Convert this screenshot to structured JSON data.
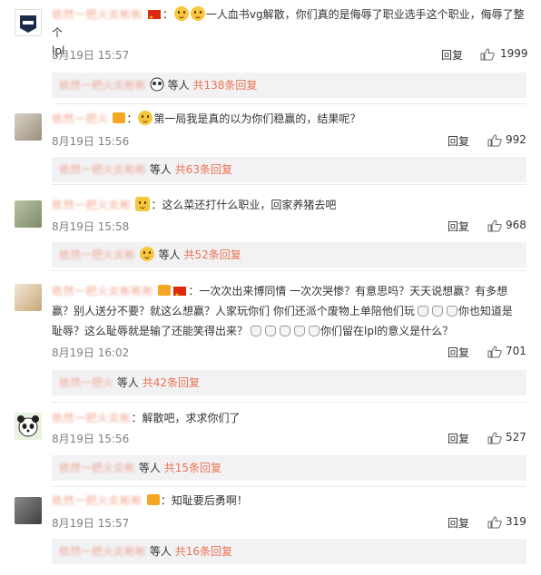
{
  "comments": [
    {
      "username": "依然一把火炎彬彬",
      "text_a": "：",
      "text_b": "一人血书vg解散，你们真的是侮辱了职业选手这个职业，侮辱了整个",
      "text_c": "lpl",
      "date": "8月19日 15:57",
      "reply": "回复",
      "likes": "1999",
      "sub": {
        "name": "依然一把火炎彬彬",
        "label": "等人",
        "count": "共138条回复"
      }
    },
    {
      "username": "依然一把火",
      "text_a": "：",
      "text_b": "第一局我是真的以为你们稳赢的，结果呢？",
      "date": "8月19日 15:56",
      "reply": "回复",
      "likes": "992",
      "sub": {
        "name": "依然一把火炎彬彬",
        "label": "等人",
        "count": "共63条回复"
      }
    },
    {
      "username": "依然一把火炎彬",
      "text_a": "：",
      "text_b": "这么菜还打什么职业，回家养猪去吧",
      "date": "8月19日 15:58",
      "reply": "回复",
      "likes": "968",
      "sub": {
        "name": "依然一把火炎彬",
        "label": "等人",
        "count": "共52条回复"
      }
    },
    {
      "username": "依然一把火炎彬彬彬",
      "text_a": "：一次次出来博同情  一次次哭惨？有意思吗？天天说想赢？有多想",
      "text_b": "赢？别人送分不要？就这么想赢？人家玩你们 你们还派个废物上单陪他们玩",
      "text_b2": "你也知道是",
      "text_c": "耻辱？这么耻辱就是输了还能笑得出来？",
      "text_d": "你们留在lpl的意义是什么？",
      "date": "8月19日 16:02",
      "reply": "回复",
      "likes": "701",
      "sub": {
        "name": "依然一把火",
        "label": "等人",
        "count": "共42条回复"
      }
    },
    {
      "username": "依然一把火炎彬",
      "text_a": "：解散吧，求求你们了",
      "date": "8月19日 15:56",
      "reply": "回复",
      "likes": "527",
      "sub": {
        "name": "依然一把火炎彬",
        "label": "等人",
        "count": "共15条回复"
      }
    },
    {
      "username": "依然一把火炎彬彬",
      "text_a": "：知耻要后勇啊！",
      "date": "8月19日 15:57",
      "reply": "回复",
      "likes": "319",
      "sub": {
        "name": "依然一把火炎彬彬",
        "label": "等人",
        "count": "共16条回复"
      }
    }
  ],
  "colors": {
    "link": "#eb7350",
    "meta": "#808080",
    "subbox": "#f2f2f5"
  },
  "icons": {
    "like": "thumbs-up-icon",
    "flag": "china-flag-icon"
  }
}
